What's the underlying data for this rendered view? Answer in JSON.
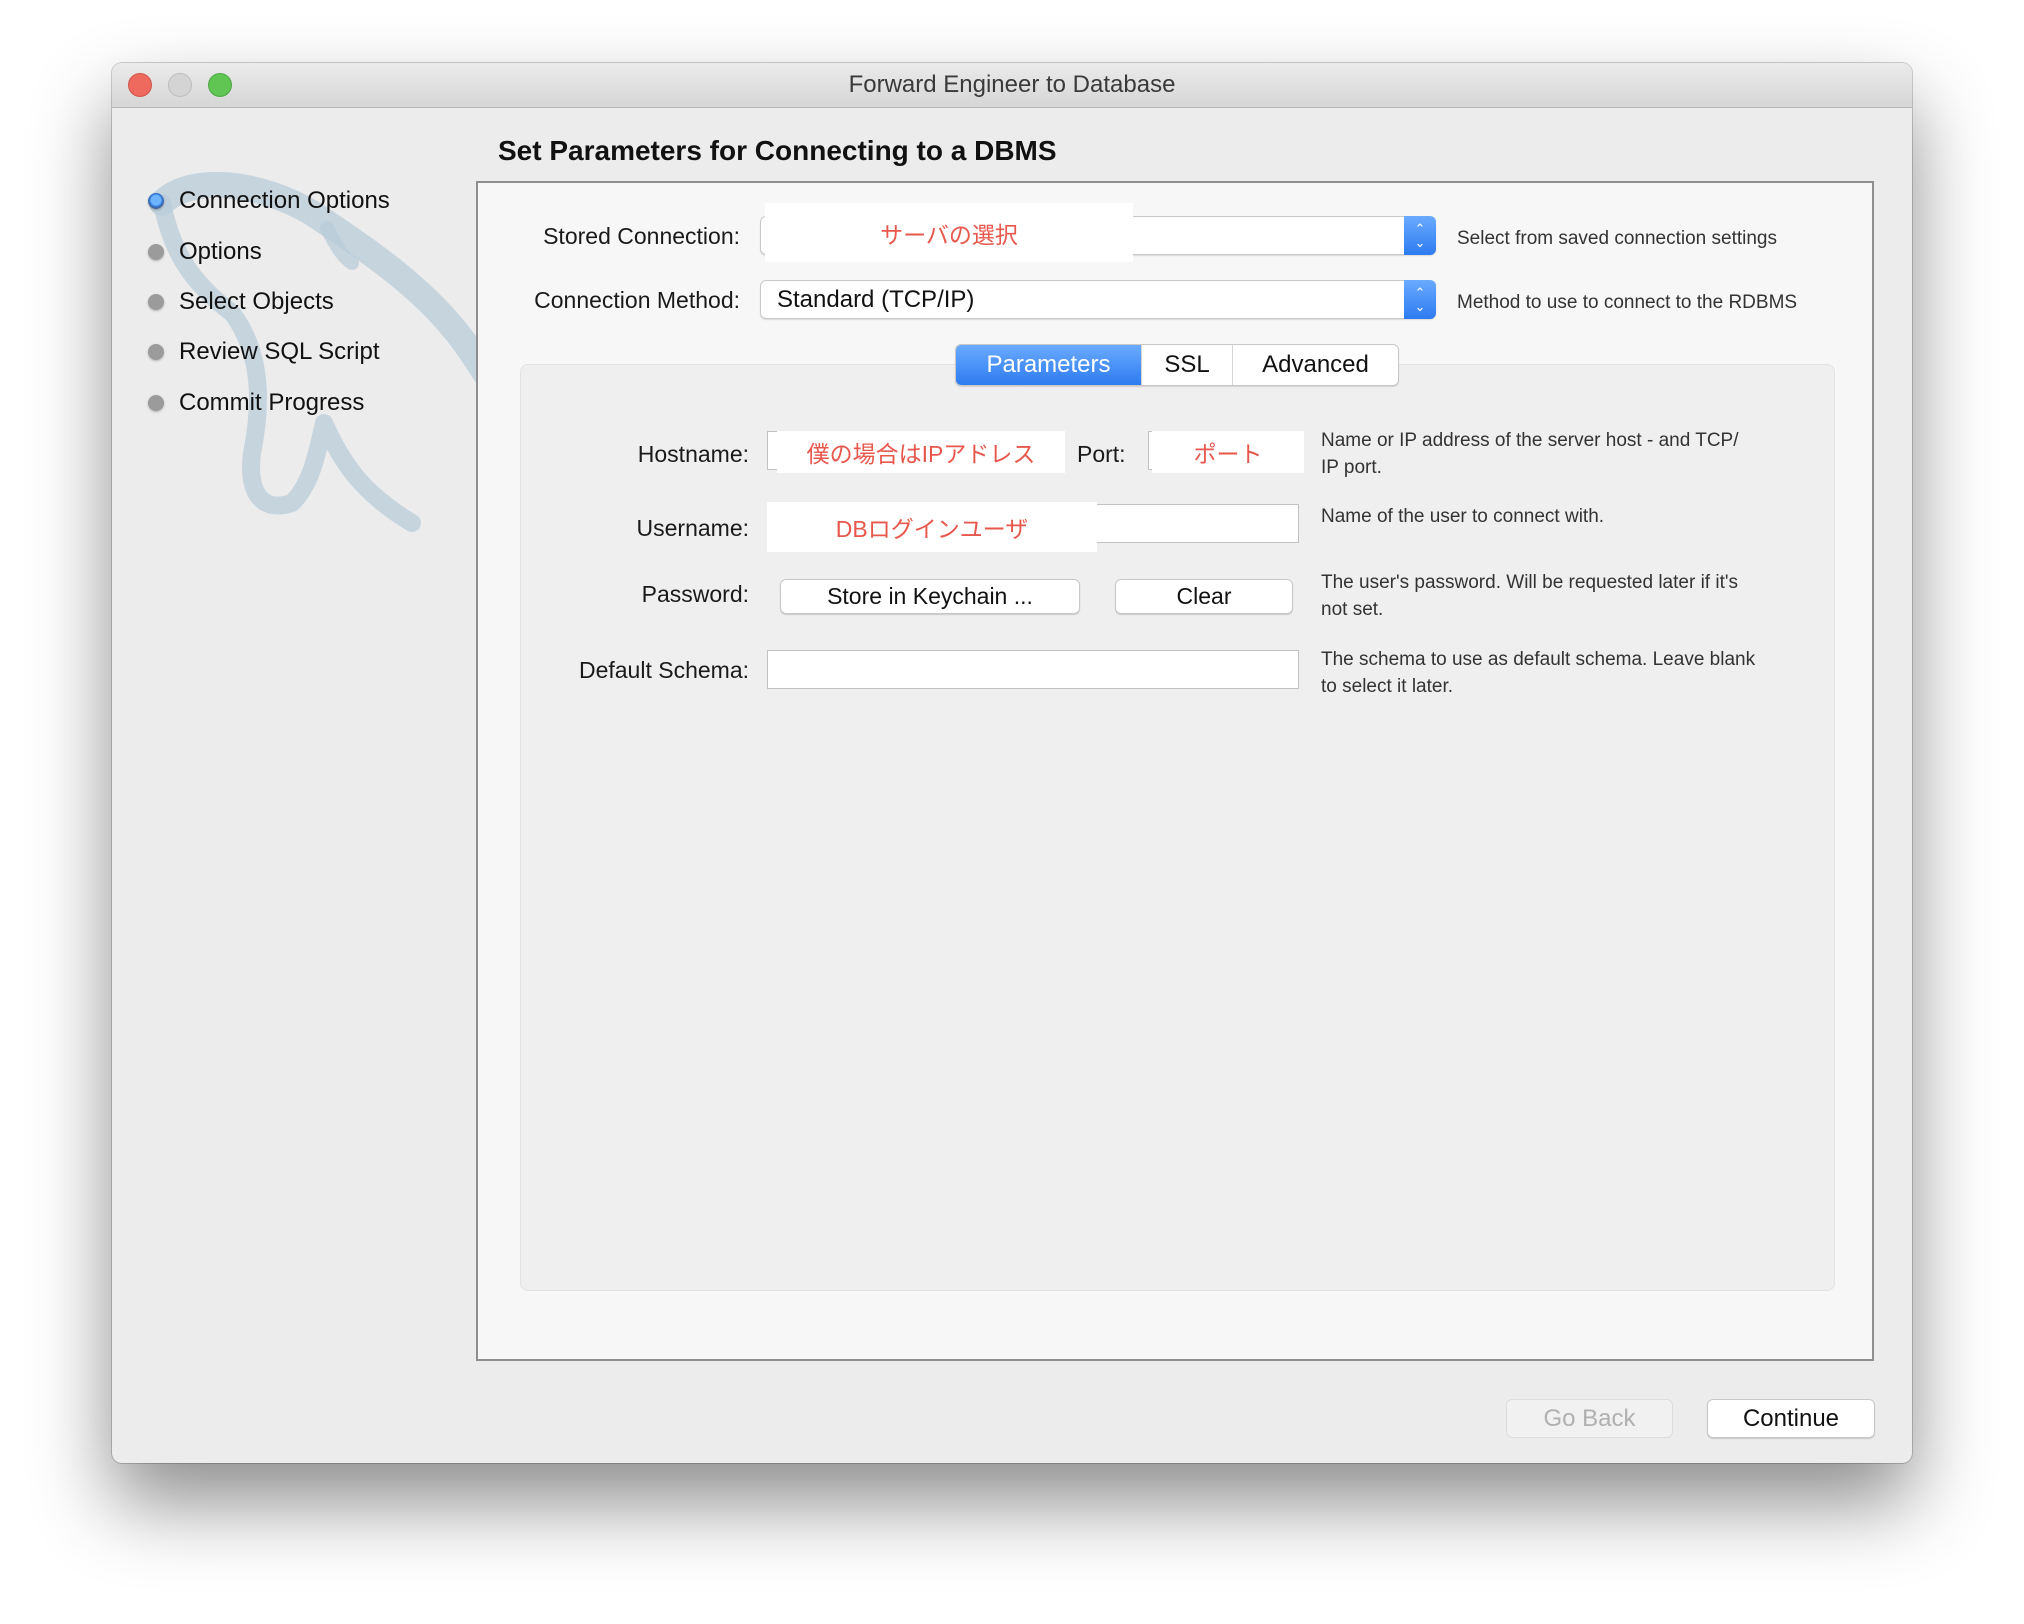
{
  "window": {
    "title": "Forward Engineer to Database"
  },
  "sidebar": {
    "items": [
      {
        "label": "Connection Options",
        "state": "active"
      },
      {
        "label": "Options",
        "state": "pending"
      },
      {
        "label": "Select Objects",
        "state": "pending"
      },
      {
        "label": "Review SQL Script",
        "state": "pending"
      },
      {
        "label": "Commit Progress",
        "state": "pending"
      }
    ]
  },
  "main": {
    "heading": "Set Parameters for Connecting to a DBMS",
    "stored_connection": {
      "label": "Stored Connection:",
      "value": "",
      "annotation": "サーバの選択",
      "help": "Select from saved connection settings"
    },
    "connection_method": {
      "label": "Connection Method:",
      "value": "Standard (TCP/IP)",
      "help": "Method to use to connect to the RDBMS"
    },
    "tabs": [
      {
        "label": "Parameters",
        "active": true
      },
      {
        "label": "SSL",
        "active": false
      },
      {
        "label": "Advanced",
        "active": false
      }
    ],
    "parameters": {
      "hostname": {
        "label": "Hostname:",
        "annotation": "僕の場合はIPアドレス",
        "help_line1": "Name or IP address of the server host - and TCP/",
        "help_line2": "IP port."
      },
      "port": {
        "label": "Port:",
        "annotation": "ポート"
      },
      "username": {
        "label": "Username:",
        "annotation": "DBログインユーザ",
        "help_line1": "Name of the user to connect with."
      },
      "password": {
        "label": "Password:",
        "store_button": "Store in Keychain ...",
        "clear_button": "Clear",
        "help_line1": "The user's password. Will be requested later if it's",
        "help_line2": "not set."
      },
      "default_schema": {
        "label": "Default Schema:",
        "value": "",
        "help_line1": "The schema to use as default schema. Leave blank",
        "help_line2": "to select it later."
      }
    }
  },
  "footer": {
    "go_back": "Go Back",
    "go_back_enabled": false,
    "continue": "Continue"
  },
  "colors": {
    "accent": "#2d7bf0",
    "annotation_red": "#e8574c"
  }
}
